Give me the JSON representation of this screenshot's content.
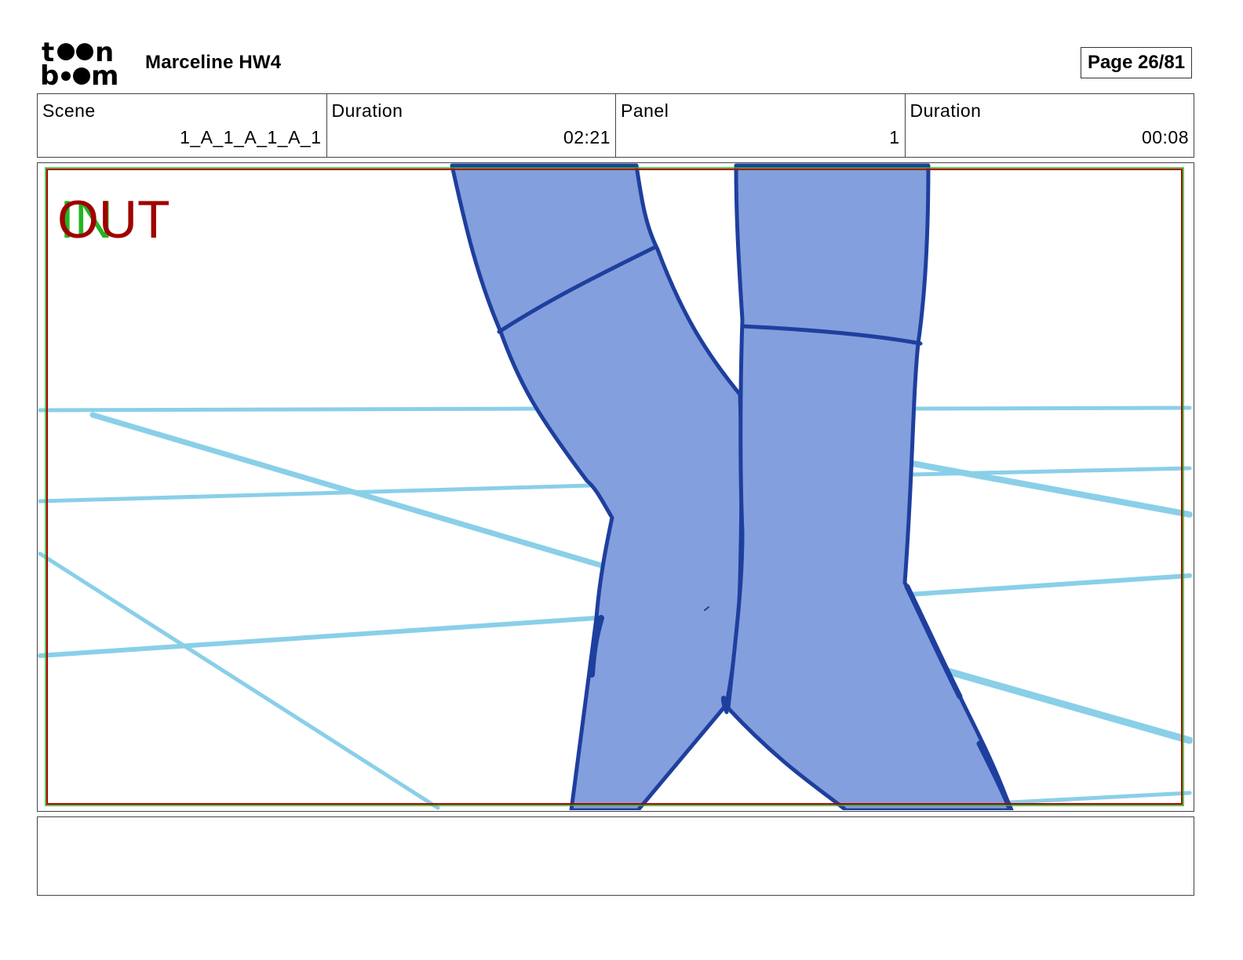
{
  "header": {
    "logo_text": [
      "toon",
      "boom"
    ],
    "project_title": "Marceline HW4",
    "page_label": "Page 26/81"
  },
  "info": {
    "scene_label": "Scene",
    "scene_value": "1_A_1_A_1_A_1",
    "scene_duration_label": "Duration",
    "scene_duration_value": "02:21",
    "panel_label": "Panel",
    "panel_value": "1",
    "panel_duration_label": "Duration",
    "panel_duration_value": "00:08"
  },
  "panel": {
    "in_marker": "IN",
    "out_marker": "OUT",
    "colors": {
      "in": "#22b522",
      "out": "#a00000",
      "legs_fill": "#839fdd",
      "legs_stroke": "#1f3f9e",
      "lines": "#8acfe8"
    }
  },
  "notes": {
    "text": ""
  }
}
